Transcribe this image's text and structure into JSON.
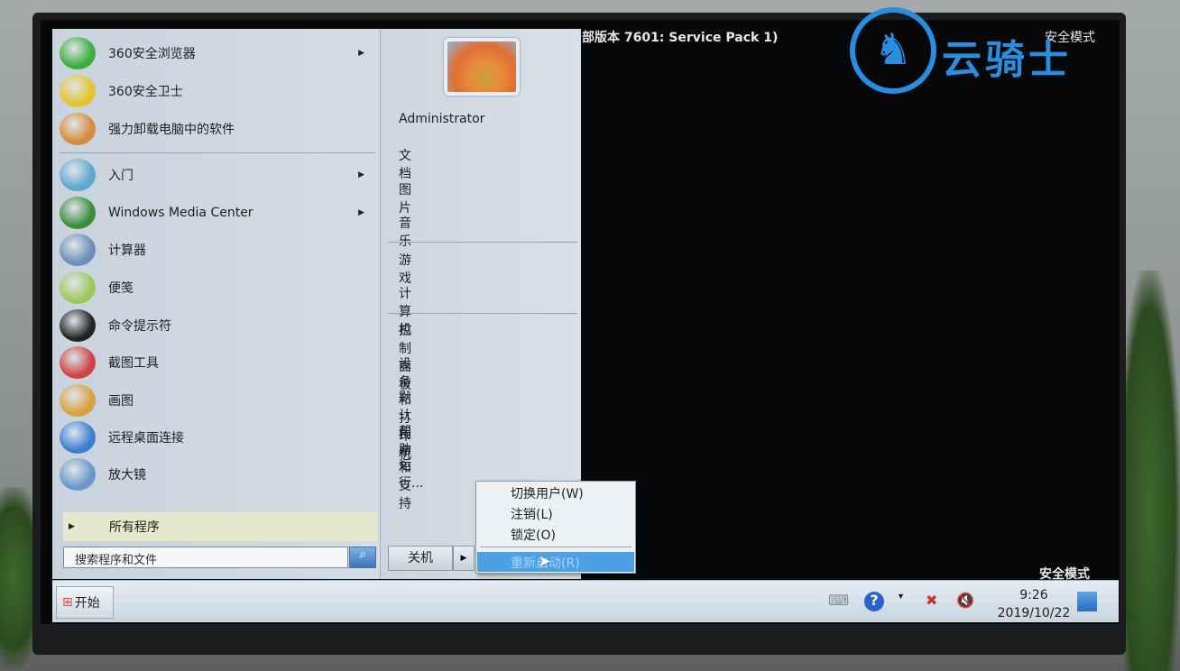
{
  "top_overlay": {
    "version_text": "部版本 7601: Service Pack 1)",
    "safe_mode_top": "安全模式",
    "safe_mode_bottom": "安全模式"
  },
  "watermark": {
    "text": "云骑士",
    "color": "#2a8ee0"
  },
  "start_menu": {
    "pinned": [
      {
        "label": "360安全浏览器",
        "icon": "360-browser-icon",
        "submenu": true
      },
      {
        "label": "360安全卫士",
        "icon": "360-safeguard-icon",
        "submenu": false
      },
      {
        "label": "强力卸载电脑中的软件",
        "icon": "uninstall-icon",
        "submenu": false
      }
    ],
    "recent": [
      {
        "label": "入门",
        "icon": "getting-started-icon",
        "submenu": true
      },
      {
        "label": "Windows Media Center",
        "icon": "media-center-icon",
        "submenu": true
      },
      {
        "label": "计算器",
        "icon": "calculator-icon",
        "submenu": false
      },
      {
        "label": "便笺",
        "icon": "sticky-notes-icon",
        "submenu": false
      },
      {
        "label": "命令提示符",
        "icon": "cmd-icon",
        "submenu": false
      },
      {
        "label": "截图工具",
        "icon": "snipping-tool-icon",
        "submenu": false
      },
      {
        "label": "画图",
        "icon": "paint-icon",
        "submenu": false
      },
      {
        "label": "远程桌面连接",
        "icon": "remote-desktop-icon",
        "submenu": false
      },
      {
        "label": "放大镜",
        "icon": "magnifier-icon",
        "submenu": false
      }
    ],
    "all_programs": "所有程序",
    "search_placeholder": "搜索程序和文件",
    "right": {
      "user": "Administrator",
      "group1": [
        "文档",
        "图片",
        "音乐"
      ],
      "group2": [
        "游戏",
        "计算机"
      ],
      "group3": [
        "控制面板",
        "设备和打印机",
        "默认程序",
        "帮助和支持",
        "运行..."
      ]
    },
    "shutdown_label": "关机",
    "shutdown_menu": [
      "切换用户(W)",
      "注销(L)",
      "锁定(O)"
    ],
    "shutdown_menu_highlighted": "重新启动(R)"
  },
  "taskbar": {
    "start_label": "开始",
    "time": "9:26",
    "date": "2019/10/22"
  },
  "colors": {
    "highlight": "#4ea0e4",
    "desktop": "#07080a"
  }
}
